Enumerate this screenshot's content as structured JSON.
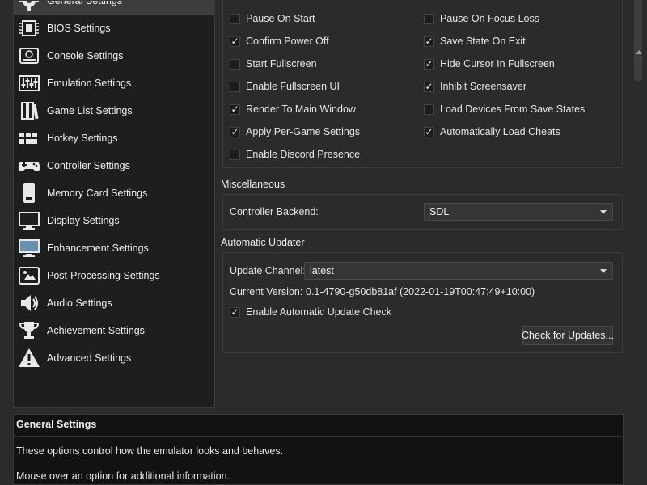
{
  "sidebar": {
    "items": [
      {
        "label": "General Settings",
        "icon": "gear-icon",
        "active": true
      },
      {
        "label": "BIOS Settings",
        "icon": "chip-icon"
      },
      {
        "label": "Console Settings",
        "icon": "console-icon"
      },
      {
        "label": "Emulation Settings",
        "icon": "sliders-icon"
      },
      {
        "label": "Game List Settings",
        "icon": "books-icon"
      },
      {
        "label": "Hotkey Settings",
        "icon": "keyboard-icon"
      },
      {
        "label": "Controller Settings",
        "icon": "gamepad-icon"
      },
      {
        "label": "Memory Card Settings",
        "icon": "memory-card-icon"
      },
      {
        "label": "Display Settings",
        "icon": "monitor-icon"
      },
      {
        "label": "Enhancement Settings",
        "icon": "display-enhance-icon"
      },
      {
        "label": "Post-Processing Settings",
        "icon": "post-processing-icon"
      },
      {
        "label": "Audio Settings",
        "icon": "speaker-icon"
      },
      {
        "label": "Achievement Settings",
        "icon": "trophy-icon"
      },
      {
        "label": "Advanced Settings",
        "icon": "warning-icon"
      }
    ]
  },
  "behaviour": {
    "left": [
      {
        "label": "Pause On Start",
        "checked": false
      },
      {
        "label": "Confirm Power Off",
        "checked": true
      },
      {
        "label": "Start Fullscreen",
        "checked": false
      },
      {
        "label": "Enable Fullscreen UI",
        "checked": false
      },
      {
        "label": "Render To Main Window",
        "checked": true
      },
      {
        "label": "Apply Per-Game Settings",
        "checked": true
      },
      {
        "label": "Enable Discord Presence",
        "checked": false
      }
    ],
    "right": [
      {
        "label": "Pause On Focus Loss",
        "checked": false
      },
      {
        "label": "Save State On Exit",
        "checked": true
      },
      {
        "label": "Hide Cursor In Fullscreen",
        "checked": true
      },
      {
        "label": "Inhibit Screensaver",
        "checked": true
      },
      {
        "label": "Load Devices From Save States",
        "checked": false
      },
      {
        "label": "Automatically Load Cheats",
        "checked": true
      }
    ]
  },
  "misc": {
    "title": "Miscellaneous",
    "controller_backend_label": "Controller Backend:",
    "controller_backend_value": "SDL"
  },
  "updater": {
    "title": "Automatic Updater",
    "channel_label": "Update Channel:",
    "channel_value": "latest",
    "version_label": "Current Version:",
    "version_value": "0.1-4790-g50db81af (2022-01-19T00:47:49+10:00)",
    "auto_check_label": "Enable Automatic Update Check",
    "auto_check_checked": true,
    "check_button": "Check for Updates..."
  },
  "info": {
    "title": "General Settings",
    "line1": "These options control how the emulator looks and behaves.",
    "line2": "Mouse over an option for additional information."
  },
  "colors": {
    "background": "#2b2b2b",
    "sidebar_bg": "#1e1e1e",
    "active_item": "#3d3d3d",
    "info_bg": "#121212"
  }
}
